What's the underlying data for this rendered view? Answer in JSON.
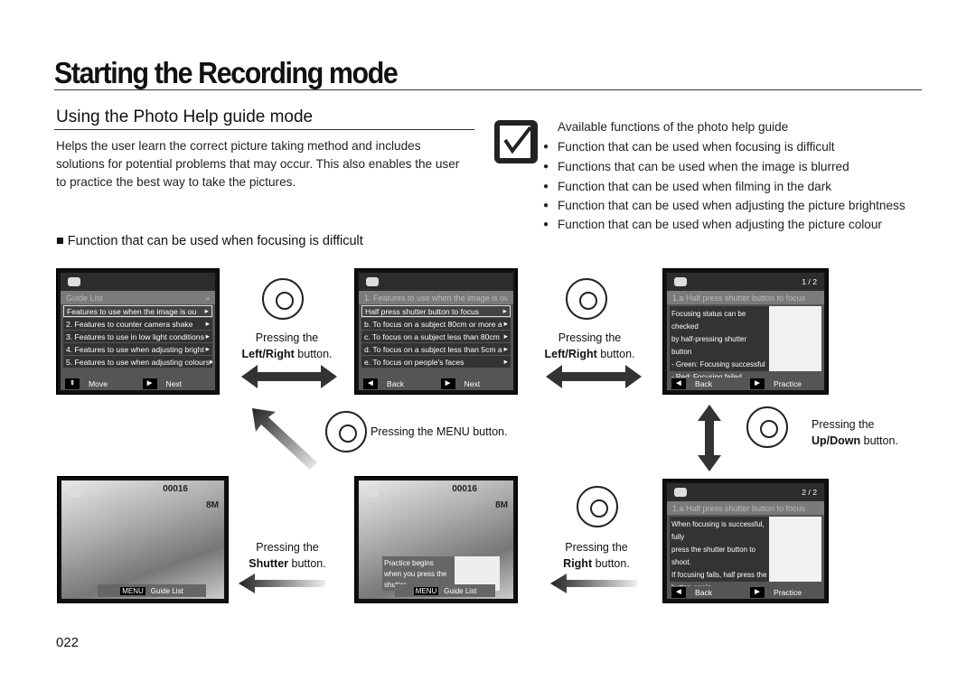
{
  "title": "Starting the Recording mode",
  "subtitle": "Using the Photo Help guide mode",
  "intro": "Helps the user learn the correct picture taking method and includes solutions for potential problems that may occur. This also enables the user to practice the best way to take the pictures.",
  "section_heading": "■  Function that can be used when focusing is difficult",
  "functions": {
    "heading": "Available functions of the photo help guide",
    "items": [
      "Function that can be used when focusing is difficult",
      "Functions that can be used when the image is blurred",
      "Function that can be used when filming in the dark",
      "Function that can be used when adjusting the picture brightness",
      "Function that can be used when adjusting the picture colour"
    ]
  },
  "screen1": {
    "header": "Guide List",
    "header_icon": "double-chevron-right",
    "items": [
      "Features to use when the image is ou",
      "2. Features to counter camera shake",
      "3. Features to use in low light conditions",
      "4. Features to use when adjusting bright",
      "5. Features to use when adjusting colours"
    ],
    "footer": [
      "Move",
      "Next"
    ]
  },
  "screen2": {
    "header": "1. Features to use when the image is ou",
    "items": [
      "Half press shutter button to focus",
      "b. To focus on a subject 80cm or more a",
      "c. To focus on a subject less than 80cm",
      "d. To focus on a subject less than 5cm a",
      "e. To focus on people's faces"
    ],
    "footer": [
      "Back",
      "Next"
    ]
  },
  "screen3": {
    "page": "1 / 2",
    "header": "1.a  Half press shutter button to focus",
    "lines": [
      "Focusing status can be checked",
      "by half-pressing shutter button",
      "- Green: Focusing successful",
      "- Red: Focusing failed"
    ],
    "footer": [
      "Back",
      "Practice"
    ]
  },
  "screen4": {
    "counter": "00016",
    "size": "8M",
    "menu": "MENU",
    "label": "Guide List"
  },
  "screen5": {
    "counter": "00016",
    "size": "8M",
    "practice": "Practice begins when you press the shutter.",
    "menu": "MENU",
    "label": "Guide List"
  },
  "screen6": {
    "page": "2 / 2",
    "header": "1.a  Half press shutter button to focus",
    "lines": [
      "When focusing is successful, fully",
      "press the shutter button to shoot.",
      "If focusing fails, half press the",
      "button again."
    ],
    "footer": [
      "Back",
      "Practice"
    ]
  },
  "captions": {
    "pressing": "Pressing the",
    "left_right": "Left/Right",
    "button": " button.",
    "menu_text": "Pressing the MENU button.",
    "up_down": "Up/Down",
    "shutter": "Shutter",
    "right": "Right"
  },
  "page_number": "022"
}
